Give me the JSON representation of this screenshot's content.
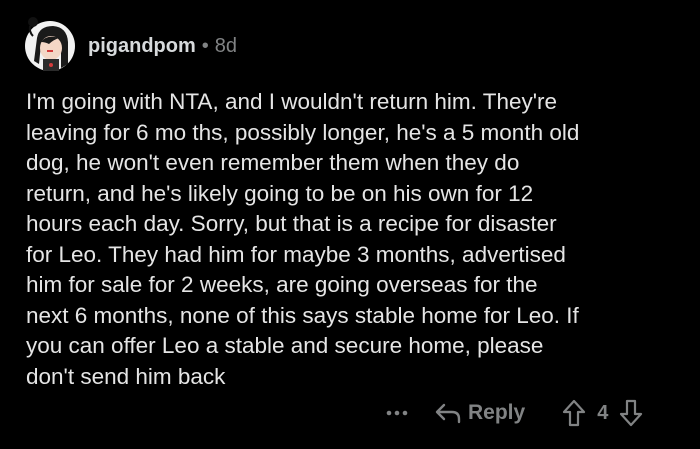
{
  "comment": {
    "username": "pigandpom",
    "separator": "•",
    "age": "8d",
    "body": "I'm going  with NTA, and I wouldn't return him. They're\nleaving for 6 mo ths, possibly longer, he's a 5 month old\ndog, he won't even remember them when they do\nreturn, and he's likely going to be on his own for 12\nhours each day. Sorry, but that is a recipe for disaster\nfor Leo. They had him for maybe 3 months, advertised\nhim for sale for 2 weeks, are going overseas for the\nnext 6 months, none of this says stable home for Leo. If\nyou can offer Leo a stable and secure home, please\ndon't send him back"
  },
  "actions": {
    "more_icon": "more-options-icon",
    "reply_icon": "reply-arrow-icon",
    "reply_label": "Reply",
    "upvote_icon": "upvote-arrow-icon",
    "vote_count": "4",
    "downvote_icon": "downvote-arrow-icon"
  },
  "colors": {
    "background": "#000000",
    "text": "#e5e5e5",
    "muted": "#818384"
  }
}
